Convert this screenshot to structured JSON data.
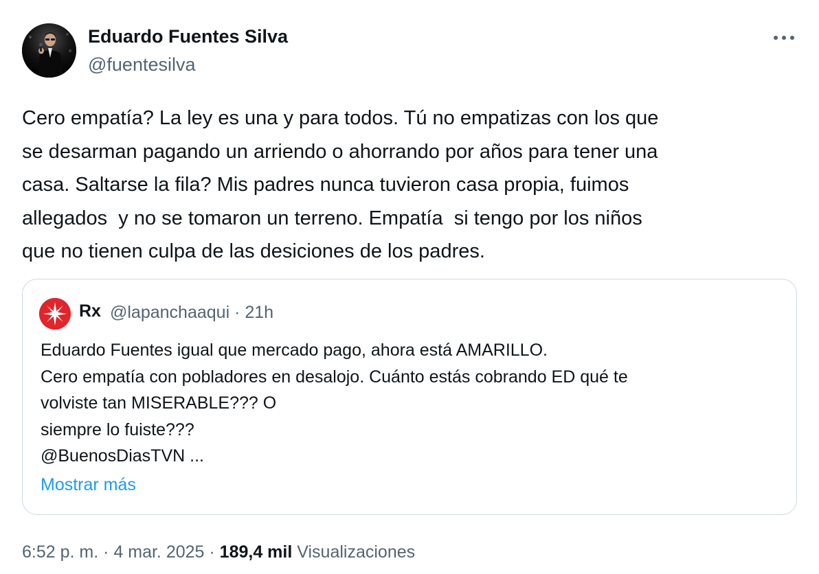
{
  "author": {
    "name": "Eduardo Fuentes Silva",
    "handle": "@fuentesilva"
  },
  "tweet": {
    "text": "Cero empatía? La ley es una y para todos. Tú no empatizas con los que\nse desarman pagando un arriendo o ahorrando por años para tener una\ncasa. Saltarse la fila? Mis padres nunca tuvieron casa propia, fuimos\nallegados  y no se tomaron un terreno. Empatía  si tengo por los niños\nque no tienen culpa de las desiciones de los padres."
  },
  "quote": {
    "name": "Rx",
    "handle": "@lapanchaaqui",
    "separator": "·",
    "time": "21h",
    "text": "Eduardo Fuentes igual que mercado pago, ahora está AMARILLO.\nCero empatía con pobladores en desalojo. Cuánto estás cobrando ED qué te\nvolviste tan MISERABLE??? O\nsiempre lo fuiste???\n@BuenosDiasTVN ...",
    "show_more_label": "Mostrar más"
  },
  "footer": {
    "time": "6:52 p. m.",
    "sep1": "·",
    "date": "4 mar. 2025",
    "sep2": "·",
    "views_count": "189,4 mil",
    "views_label": "Visualizaciones"
  },
  "colors": {
    "text": "#0f1419",
    "secondary": "#536471",
    "link": "#1d9bf0",
    "border": "#cfd9de",
    "quote_avatar": "#e0252b"
  },
  "icons": {
    "more": "more-dots-icon",
    "quote_avatar_symbol": "star-burst-icon"
  }
}
